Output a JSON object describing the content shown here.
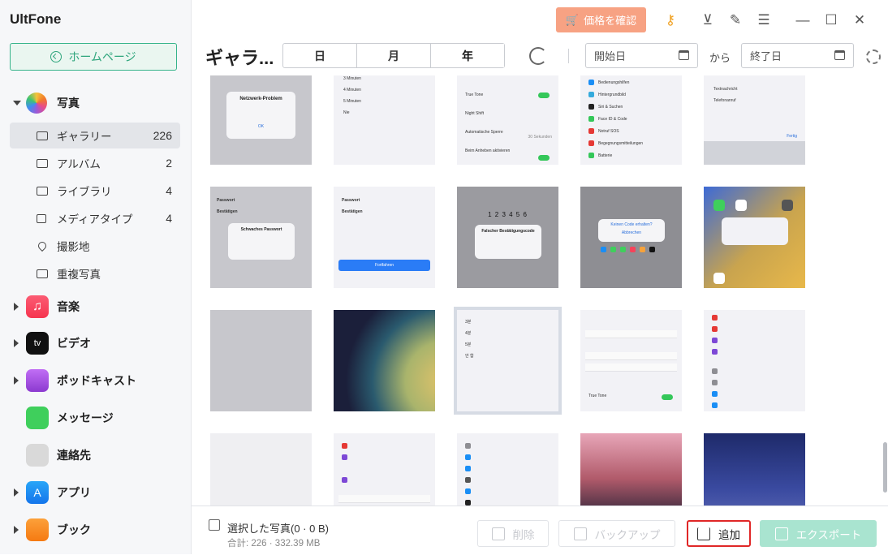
{
  "app": {
    "title": "UltFone"
  },
  "sidebar": {
    "home": "ホームページ",
    "categories": [
      {
        "label": "写真",
        "icon": "photos-app-icon",
        "color": "#f6a23b"
      },
      {
        "label": "音楽",
        "icon": "music-app-icon",
        "color": "#f6435a"
      },
      {
        "label": "ビデオ",
        "icon": "appletv-app-icon",
        "color": "#111111"
      },
      {
        "label": "ポッドキャスト",
        "icon": "podcasts-app-icon",
        "color": "#9d47d8"
      },
      {
        "label": "メッセージ",
        "icon": "messages-app-icon",
        "color": "#3fcf5c"
      },
      {
        "label": "連絡先",
        "icon": "contacts-app-icon",
        "color": "#c9c9c9"
      },
      {
        "label": "アプリ",
        "icon": "appstore-app-icon",
        "color": "#1a8ef5"
      },
      {
        "label": "ブック",
        "icon": "books-app-icon",
        "color": "#f88a1c"
      }
    ],
    "photo_items": [
      {
        "label": "ギャラリー",
        "count": "226"
      },
      {
        "label": "アルバム",
        "count": "2"
      },
      {
        "label": "ライブラリ",
        "count": "4"
      },
      {
        "label": "メディアタイプ",
        "count": "4"
      },
      {
        "label": "撮影地",
        "count": ""
      },
      {
        "label": "重複写真",
        "count": ""
      }
    ]
  },
  "topbar": {
    "price_button": "価格を確認"
  },
  "toolbar": {
    "title": "ギャラ...",
    "segments": [
      "日",
      "月",
      "年"
    ],
    "active_segment": "年",
    "start_date_placeholder": "開始日",
    "to_label": "から",
    "end_date_placeholder": "終了日"
  },
  "thumbnail_text": {
    "t1_title": "Netzwerk-Problem",
    "t1_ok": "OK",
    "t2_rows": [
      "3 Minuten",
      "4 Minuten",
      "5 Minuten",
      "Nie"
    ],
    "t3_rows": [
      "True Tone",
      "Night Shift",
      "Automatische Sperre",
      "Beim Anheben aktivieren"
    ],
    "t3_value": "30 Sekunden",
    "t4_rows": [
      "Bedienungshilfen",
      "Hintergrundbild",
      "Siri & Suchen",
      "Face ID & Code",
      "Notruf SOS",
      "Begegnungsmitteilungen",
      "Batterie"
    ],
    "t5_rows": [
      "Textnachricht",
      "Telefonanruf"
    ],
    "t5_done": "Fertig",
    "t6_rows": [
      "Passwort",
      "Bestätigen"
    ],
    "t6_title": "Schwaches Passwort",
    "t7_button": "Fortfahren",
    "t8_digits": "1 2 3 4 5 6",
    "t8_title": "Falscher Bestätigungscode",
    "t9_link": "Keinen Code erhalten?",
    "t9_cancel": "Abbrechen",
    "t13_rows": [
      "3분",
      "4분",
      "5분",
      "안 함"
    ],
    "t14_row": "True Tone"
  },
  "bottom": {
    "select_label": "選択した写真(0 · 0 B)",
    "total_label": "合計: 226 · 332.39 MB",
    "delete_label": "削除",
    "backup_label": "バックアップ",
    "add_label": "追加",
    "export_label": "エクスポート"
  }
}
